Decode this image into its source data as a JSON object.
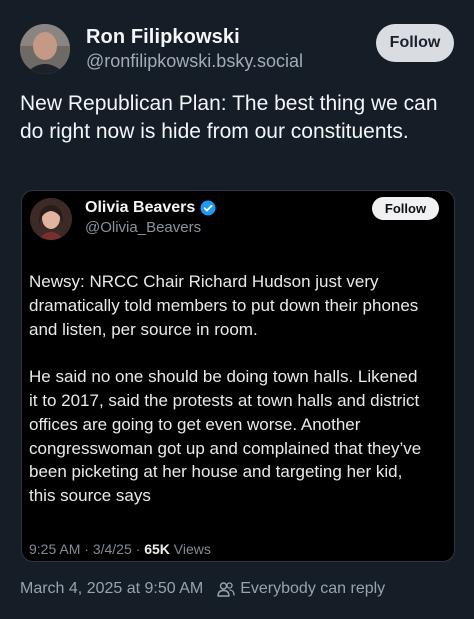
{
  "post": {
    "author_name": "Ron Filipkowski",
    "author_handle": "@ronfilipkowski.bsky.social",
    "follow_label": "Follow",
    "text": "New Republican Plan: The best thing we can do right now is hide from our constituents.",
    "timestamp": "March 4, 2025 at 9:50 AM",
    "reply_setting": "Everybody can reply"
  },
  "embed": {
    "author_name": "Olivia Beavers",
    "author_handle": "@Olivia_Beavers",
    "follow_label": "Follow",
    "paragraphs": [
      "Newsy: NRCC Chair Richard Hudson just very dramatically told members to put down their phones and listen, per source in room.",
      "He said no one should be doing town halls. Likened it to 2017, said the protests at town halls and district offices are going to get even worse. Another congresswoman got up and complained that they’ve been picketing at her house and targeting her kid, this source says"
    ],
    "time": "9:25 AM",
    "date": "3/4/25",
    "separator": "·",
    "views_count": "65K",
    "views_label": "Views"
  },
  "icons": {
    "verified": "verified-badge-icon",
    "people": "people-icon"
  },
  "colors": {
    "background": "#151d27",
    "embed_background": "#000000",
    "verified_blue": "#1d9bf0",
    "follow_bg": "#d9dde2"
  }
}
